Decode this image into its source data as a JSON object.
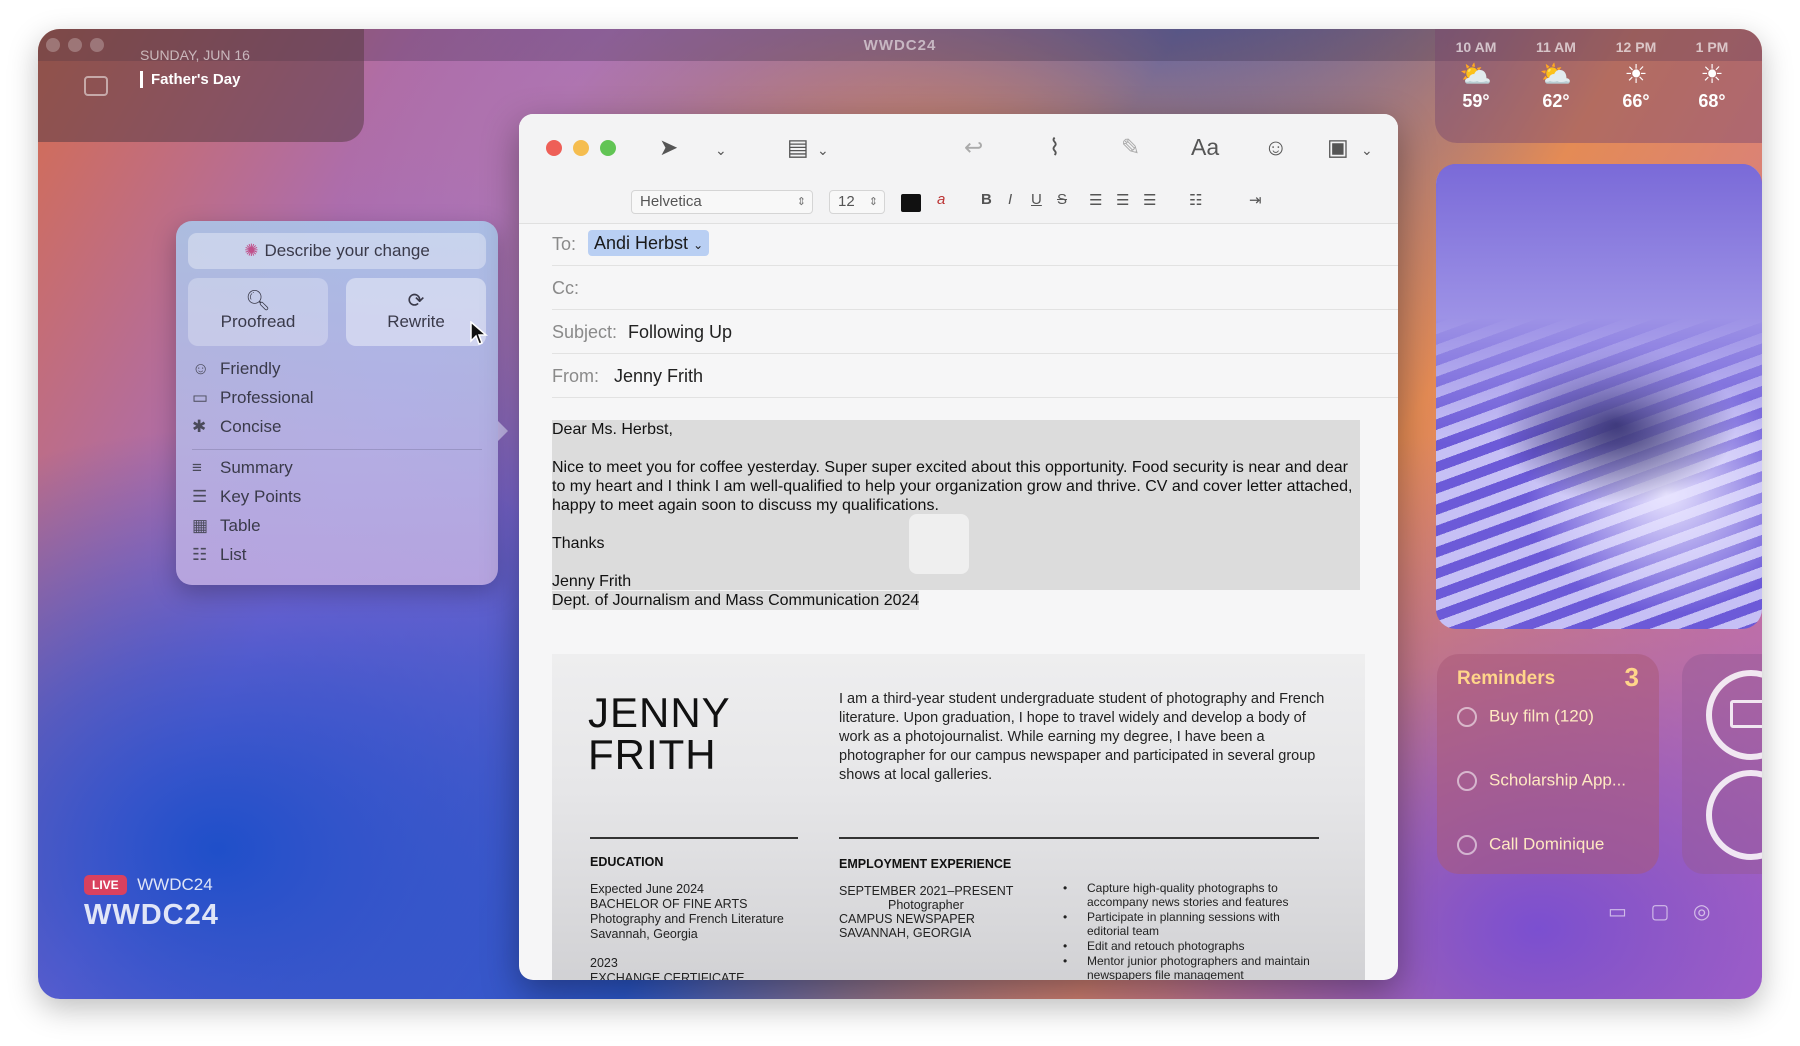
{
  "window_title": "WWDC24",
  "calendar": {
    "date": "SUNDAY, JUN 16",
    "event": "Father's Day"
  },
  "weather": [
    {
      "time": "10 AM",
      "icon": "partly-cloudy-icon",
      "glyph": "⛅",
      "temp": "59°"
    },
    {
      "time": "11 AM",
      "icon": "partly-cloudy-icon",
      "glyph": "⛅",
      "temp": "62°"
    },
    {
      "time": "12 PM",
      "icon": "sun-icon",
      "glyph": "☀",
      "temp": "66°"
    },
    {
      "time": "1 PM",
      "icon": "sun-icon",
      "glyph": "☀",
      "temp": "68°"
    }
  ],
  "reminders": {
    "title": "Reminders",
    "count": "3",
    "items": [
      "Buy film (120)",
      "Scholarship App...",
      "Call Dominique"
    ]
  },
  "live": {
    "badge": "LIVE",
    "label": "WWDC24",
    "big": "WWDC24"
  },
  "writing_tools": {
    "describe": "Describe your change",
    "proofread": "Proofread",
    "rewrite": "Rewrite",
    "tones": [
      "Friendly",
      "Professional",
      "Concise"
    ],
    "formats": [
      "Summary",
      "Key Points",
      "Table",
      "List"
    ]
  },
  "mail": {
    "font": "Helvetica",
    "size": "12",
    "to_label": "To:",
    "to_value": "Andi Herbst",
    "cc_label": "Cc:",
    "subject_label": "Subject:",
    "subject_value": "Following Up",
    "from_label": "From:",
    "from_value": "Jenny Frith",
    "body": {
      "greeting": "Dear Ms. Herbst,",
      "p1": "Nice to meet you for coffee yesterday. Super super excited about this opportunity. Food security is near and dear",
      "p2": "to my heart and I think I am well-qualified to help your organization grow and thrive. CV and cover letter attached,",
      "p3": "happy to meet again soon to discuss my qualifications.",
      "thanks": "Thanks",
      "sig_name": "Jenny Frith",
      "sig_dept": "Dept. of Journalism and Mass Communication 2024"
    }
  },
  "resume": {
    "name_1": "JENNY",
    "name_2": "FRITH",
    "about": "I am a third-year student undergraduate student of photography and French literature. Upon graduation, I hope to travel widely and develop a body of work as a photojournalist. While earning my degree, I have been a photographer for our campus newspaper and participated in several group shows at local galleries.",
    "education_heading": "EDUCATION",
    "edu_1": "Expected June 2024",
    "edu_2": "BACHELOR OF FINE ARTS",
    "edu_3": "Photography and French Literature",
    "edu_4": "Savannah, Georgia",
    "edu_5": "2023",
    "edu_6": "EXCHANGE CERTIFICATE",
    "employment_heading": "EMPLOYMENT EXPERIENCE",
    "emp_1": "SEPTEMBER 2021–PRESENT",
    "emp_2": "Photographer",
    "emp_3": "CAMPUS NEWSPAPER",
    "emp_4": "SAVANNAH, GEORGIA",
    "bullets": [
      "Capture high-quality photographs to accompany news stories and features",
      "Participate in planning sessions with editorial team",
      "Edit and retouch photographs",
      "Mentor junior photographers and maintain newspapers file management"
    ]
  }
}
